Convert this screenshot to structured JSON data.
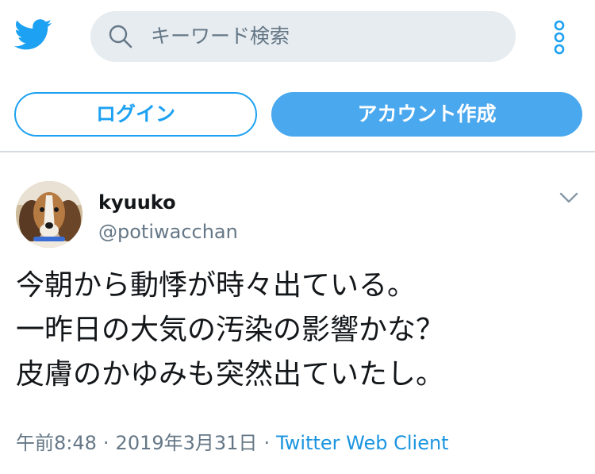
{
  "header": {
    "logo_icon": "twitter-bird-icon",
    "search_placeholder": "キーワード検索",
    "menu_icon": "more-vertical-icon",
    "brand_color": "#1da1f2"
  },
  "auth": {
    "login_label": "ログイン",
    "signup_label": "アカウント作成"
  },
  "tweet": {
    "display_name": "kyuuko",
    "handle": "@potiwacchan",
    "lines": [
      "今朝から動悸が時々出ている。",
      "一昨日の大気の汚染の影響かな？",
      "皮膚のかゆみも突然出ていたし。"
    ],
    "time": "午前8:48",
    "date": "2019年3月31日",
    "separator": "·",
    "source": "Twitter Web Client",
    "avatar_icon": "dog-avatar",
    "caret_icon": "chevron-down-icon"
  }
}
